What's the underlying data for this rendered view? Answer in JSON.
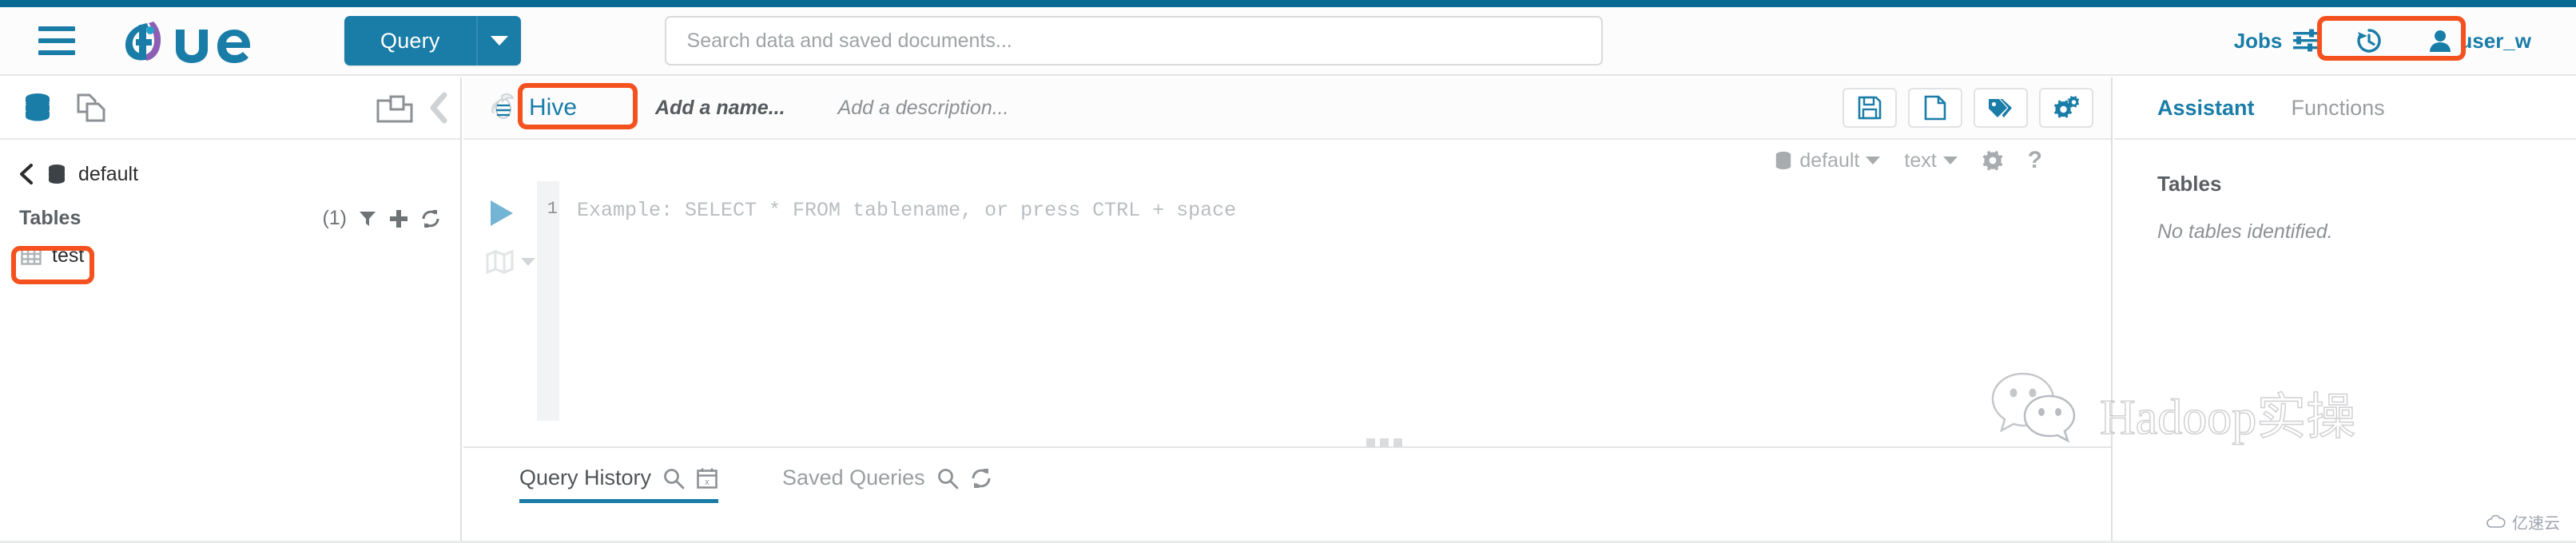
{
  "header": {
    "menu_icon": "hamburger-menu-icon",
    "logo_text": "hue",
    "query_button": "Query",
    "query_caret_icon": "chevron-down-icon",
    "search_placeholder": "Search data and saved documents...",
    "search_value": "",
    "jobs_label": "Jobs",
    "jobs_icon": "sliders-icon",
    "history_icon": "history-clock-icon",
    "user_name": "user_w",
    "user_icon": "user-icon"
  },
  "left_panel": {
    "db_icon": "database-icon",
    "documents_icon": "documents-icon",
    "folder_icon": "open-folder-icon",
    "collapse_icon": "chevron-left-icon",
    "back_icon": "chevron-left-icon",
    "breadcrumb_db": "default",
    "section_title": "Tables",
    "count": "(1)",
    "filter_icon": "filter-icon",
    "add_icon": "plus-icon",
    "refresh_icon": "refresh-icon",
    "tables": [
      {
        "name": "test",
        "icon": "table-grid-icon",
        "highlighted": true
      }
    ]
  },
  "editor": {
    "engine_label": "Hive",
    "engine_icon": "hive-bee-icon",
    "name_placeholder": "Add a name...",
    "description_placeholder": "Add a description...",
    "toolbar": [
      {
        "label": "Save",
        "icon": "save-floppy-icon"
      },
      {
        "label": "New",
        "icon": "new-document-icon"
      },
      {
        "label": "Tags",
        "icon": "tag-icon"
      },
      {
        "label": "Settings",
        "icon": "gears-icon"
      }
    ],
    "context": {
      "database": "default",
      "database_icon": "database-icon",
      "format": "text",
      "settings_icon": "gear-icon",
      "help_icon": "question-mark-icon"
    },
    "run_icon": "play-triangle-icon",
    "map_icon": "map-icon",
    "map_caret_icon": "chevron-down-icon",
    "line_number": "1",
    "code_placeholder": "Example: SELECT * FROM tablename, or press CTRL + space",
    "code_value": "",
    "splitter_icon": "drag-handle-dots",
    "tabs": [
      {
        "label": "Query History",
        "active": true,
        "icons": [
          "search-icon",
          "calendar-clear-icon"
        ]
      },
      {
        "label": "Saved Queries",
        "active": false,
        "icons": [
          "search-icon",
          "refresh-icon"
        ]
      }
    ]
  },
  "right_panel": {
    "tabs": [
      {
        "label": "Assistant",
        "active": true
      },
      {
        "label": "Functions",
        "active": false
      }
    ],
    "section_heading": "Tables",
    "empty_message": "No tables identified."
  },
  "watermarks": {
    "hadoop_text": "Hadoop实操",
    "hadoop_icon": "wechat-bubbles-icon",
    "corner_text": "亿速云",
    "corner_icon": "cloud-icon"
  },
  "colors": {
    "brand_blue": "#1a7da8",
    "top_stripe": "#0b6a94",
    "highlight_orange": "#f4511e",
    "muted_gray": "#9a9ea1"
  }
}
